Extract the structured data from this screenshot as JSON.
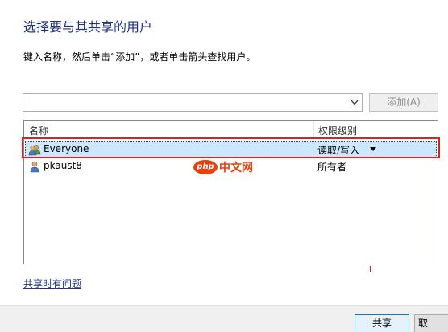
{
  "dialog": {
    "title": "选择要与其共享的用户",
    "instruction": "键入名称，然后单击“添加”，或者单击箭头查找用户。"
  },
  "add_row": {
    "input_value": "",
    "add_label": "添加(A)"
  },
  "table": {
    "columns": [
      "名称",
      "权限级别"
    ],
    "rows": [
      {
        "name": "Everyone",
        "permission": "读取/写入",
        "icon": "users-group-icon",
        "selected": true
      },
      {
        "name": "pkaust8",
        "permission": "所有者",
        "icon": "user-icon",
        "selected": false
      }
    ]
  },
  "watermark": {
    "badge": "php",
    "text": "中文网"
  },
  "help_link": "共享时有问题",
  "footer": {
    "share_label": "共享",
    "cancel_label": "取"
  },
  "colors": {
    "title": "#1e3287",
    "selection": "#cce8ff",
    "highlight": "#e02020",
    "watermark": "#e8400c"
  }
}
